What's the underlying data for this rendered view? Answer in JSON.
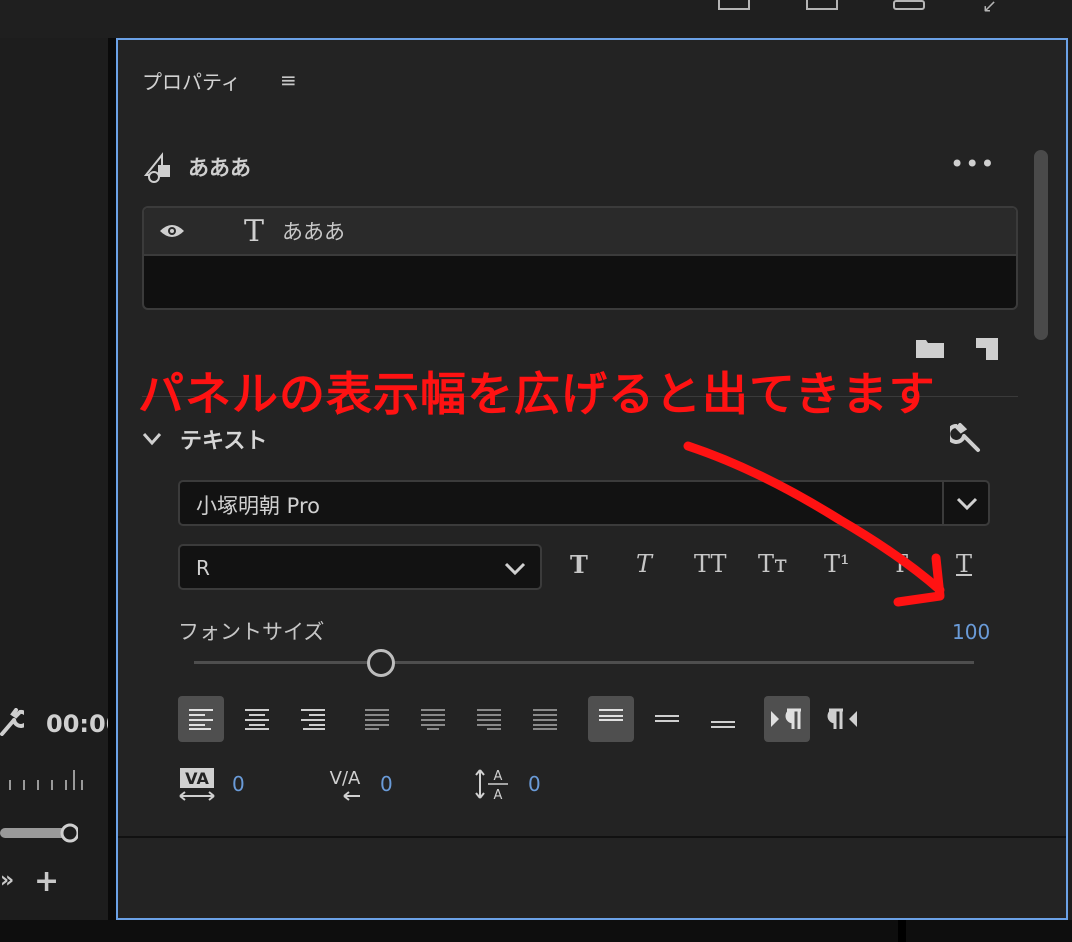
{
  "panel": {
    "title": "プロパティ",
    "menu_icon": "≡",
    "clip_name": "あああ",
    "more_label": "•••"
  },
  "layers": [
    {
      "name": "あああ",
      "type_glyph": "T",
      "visible": true
    }
  ],
  "annotation": {
    "text": "パネルの表示幅を広げると出てきます",
    "color": "#ff1212"
  },
  "text_section": {
    "title": "テキスト",
    "font_family": "小塚明朝 Pro",
    "font_style": "R",
    "style_buttons": [
      "T",
      "T",
      "TT",
      "Tт",
      "T¹",
      "T",
      "T"
    ],
    "font_size_label": "フォントサイズ",
    "font_size_value": "100",
    "font_size_slider": 0.24,
    "tracking_value": "0",
    "kerning_value": "0",
    "baseline_value": "0"
  },
  "left_panel": {
    "timecode": "00:00"
  },
  "colors": {
    "accent": "#6ba1e6",
    "value_blue": "#6a9bd8",
    "panel_bg": "#232323"
  }
}
